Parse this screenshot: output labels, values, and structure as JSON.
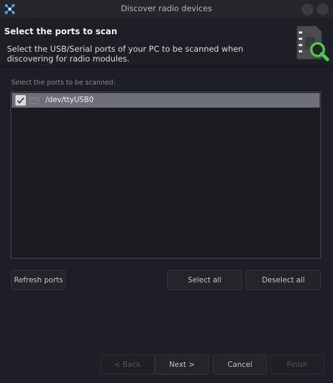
{
  "window": {
    "title": "Discover radio devices"
  },
  "header": {
    "title": "Select the ports to scan",
    "description": "Select the USB/Serial ports of your PC to be scanned when discovering for radio modules."
  },
  "ports": {
    "label": "Select the ports to be scanned:",
    "items": [
      {
        "name": "/dev/ttyUSB0",
        "checked": true
      }
    ]
  },
  "buttons": {
    "refresh": "Refresh ports",
    "select_all": "Select all",
    "deselect_all": "Deselect all",
    "back": "< Back",
    "next": "Next >",
    "cancel": "Cancel",
    "finish": "Finish"
  },
  "icons": {
    "app": "network-nodes-icon",
    "header": "device-search-icon",
    "port": "serial-port-icon"
  },
  "colors": {
    "accent_green": "#4cc84a",
    "selected_row": "#6e7079",
    "background": "#1e1f26"
  }
}
